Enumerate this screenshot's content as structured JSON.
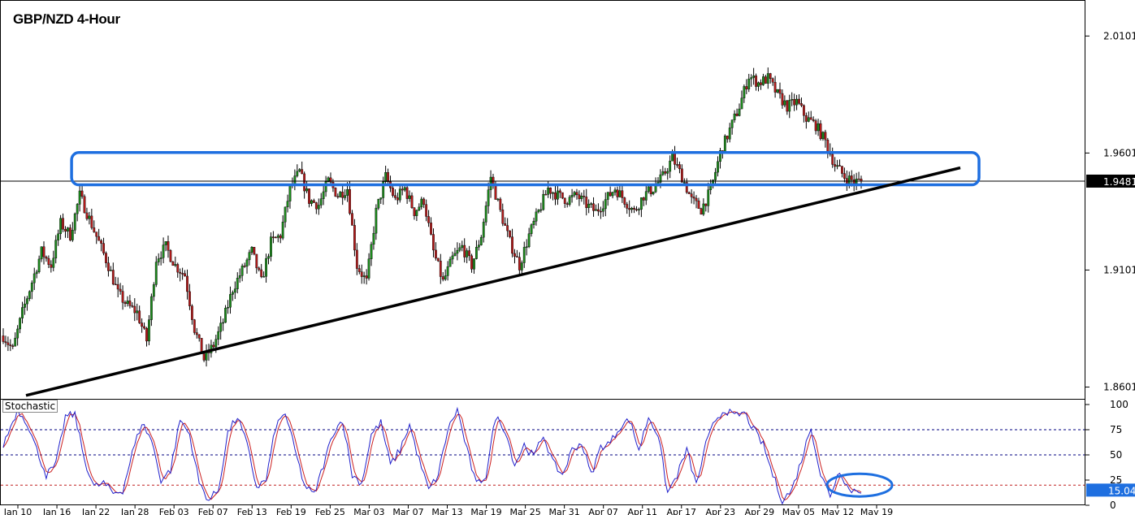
{
  "title": "GBP/NZD 4-Hour",
  "indicator_label": "Stochastic",
  "colors": {
    "bull": "#1c8a1c",
    "bear": "#b31b1b",
    "wick": "#000000",
    "annotation": "#1e6fe0",
    "trendline": "#000000",
    "stoch_main": "#2020cc",
    "stoch_signal": "#cc2020",
    "level_line": "#000080",
    "level_line_red": "#c02020",
    "price_box": "#000000",
    "stoch_box": "#1e6fe0"
  },
  "chart_data": [
    {
      "type": "candlestick",
      "title": "GBP/NZD 4-Hour",
      "y_ticks": [
        "2.0101",
        "1.9601",
        "1.9101",
        "1.8601"
      ],
      "ylim": [
        1.8561,
        2.0241
      ],
      "x_ticks": [
        "Jan 10",
        "Jan 16",
        "Jan 22",
        "Jan 28",
        "Feb 03",
        "Feb 07",
        "Feb 13",
        "Feb 19",
        "Feb 25",
        "Mar 03",
        "Mar 07",
        "Mar 13",
        "Mar 19",
        "Mar 25",
        "Mar 31",
        "Apr 07",
        "Apr 11",
        "Apr 17",
        "Apr 23",
        "Apr 29",
        "May 05",
        "May 12",
        "May 19"
      ],
      "current_price": "1.9481",
      "approx_close_path": [
        [
          0,
          1.882
        ],
        [
          4,
          1.876
        ],
        [
          8,
          1.892
        ],
        [
          12,
          1.905
        ],
        [
          16,
          1.918
        ],
        [
          20,
          1.912
        ],
        [
          24,
          1.93
        ],
        [
          28,
          1.925
        ],
        [
          32,
          1.942
        ],
        [
          36,
          1.932
        ],
        [
          40,
          1.922
        ],
        [
          44,
          1.912
        ],
        [
          48,
          1.9
        ],
        [
          52,
          1.895
        ],
        [
          56,
          1.892
        ],
        [
          60,
          1.88
        ],
        [
          64,
          1.915
        ],
        [
          68,
          1.92
        ],
        [
          72,
          1.912
        ],
        [
          76,
          1.908
        ],
        [
          80,
          1.885
        ],
        [
          84,
          1.872
        ],
        [
          88,
          1.878
        ],
        [
          92,
          1.888
        ],
        [
          96,
          1.902
        ],
        [
          100,
          1.91
        ],
        [
          104,
          1.918
        ],
        [
          108,
          1.905
        ],
        [
          112,
          1.922
        ],
        [
          116,
          1.925
        ],
        [
          120,
          1.945
        ],
        [
          124,
          1.952
        ],
        [
          128,
          1.94
        ],
        [
          132,
          1.938
        ],
        [
          136,
          1.948
        ],
        [
          140,
          1.942
        ],
        [
          144,
          1.945
        ],
        [
          148,
          1.912
        ],
        [
          152,
          1.905
        ],
        [
          156,
          1.935
        ],
        [
          160,
          1.95
        ],
        [
          164,
          1.94
        ],
        [
          168,
          1.945
        ],
        [
          172,
          1.935
        ],
        [
          176,
          1.94
        ],
        [
          180,
          1.918
        ],
        [
          184,
          1.905
        ],
        [
          188,
          1.915
        ],
        [
          192,
          1.92
        ],
        [
          196,
          1.912
        ],
        [
          200,
          1.925
        ],
        [
          204,
          1.95
        ],
        [
          208,
          1.935
        ],
        [
          212,
          1.922
        ],
        [
          216,
          1.912
        ],
        [
          220,
          1.925
        ],
        [
          224,
          1.935
        ],
        [
          228,
          1.945
        ],
        [
          232,
          1.942
        ],
        [
          236,
          1.94
        ],
        [
          240,
          1.942
        ],
        [
          244,
          1.938
        ],
        [
          248,
          1.935
        ],
        [
          252,
          1.94
        ],
        [
          256,
          1.945
        ],
        [
          260,
          1.94
        ],
        [
          264,
          1.935
        ],
        [
          268,
          1.942
        ],
        [
          272,
          1.945
        ],
        [
          276,
          1.95
        ],
        [
          280,
          1.958
        ],
        [
          284,
          1.95
        ],
        [
          288,
          1.94
        ],
        [
          292,
          1.936
        ],
        [
          296,
          1.944
        ],
        [
          300,
          1.96
        ],
        [
          304,
          1.97
        ],
        [
          308,
          1.98
        ],
        [
          312,
          1.993
        ],
        [
          316,
          1.99
        ],
        [
          320,
          1.992
        ],
        [
          324,
          1.985
        ],
        [
          328,
          1.98
        ],
        [
          332,
          1.982
        ],
        [
          336,
          1.975
        ],
        [
          340,
          1.972
        ],
        [
          344,
          1.965
        ],
        [
          348,
          1.955
        ],
        [
          352,
          1.95
        ],
        [
          356,
          1.948
        ]
      ],
      "annotations": [
        {
          "kind": "rounded-rectangle",
          "from_date": "Jan 22",
          "to_date": "May 19",
          "price_low": 1.9465,
          "price_high": 1.9603
        },
        {
          "kind": "trendline",
          "from": [
            "Jan 10",
            1.8565
          ],
          "to": [
            "May 19",
            1.9538
          ]
        }
      ]
    },
    {
      "type": "line",
      "title": "Stochastic",
      "y_ticks": [
        "100",
        "75",
        "50",
        "25",
        "0"
      ],
      "ylim": [
        0,
        100
      ],
      "levels": [
        75,
        50,
        20
      ],
      "current_value": "15.04",
      "approx_k_path": [
        [
          0,
          60
        ],
        [
          6,
          95
        ],
        [
          10,
          82
        ],
        [
          14,
          55
        ],
        [
          18,
          30
        ],
        [
          22,
          40
        ],
        [
          26,
          88
        ],
        [
          30,
          90
        ],
        [
          34,
          45
        ],
        [
          38,
          18
        ],
        [
          42,
          22
        ],
        [
          46,
          12
        ],
        [
          50,
          15
        ],
        [
          54,
          52
        ],
        [
          58,
          82
        ],
        [
          62,
          65
        ],
        [
          66,
          25
        ],
        [
          70,
          35
        ],
        [
          74,
          85
        ],
        [
          78,
          70
        ],
        [
          82,
          22
        ],
        [
          86,
          5
        ],
        [
          90,
          15
        ],
        [
          94,
          72
        ],
        [
          98,
          88
        ],
        [
          102,
          60
        ],
        [
          106,
          18
        ],
        [
          110,
          25
        ],
        [
          114,
          78
        ],
        [
          118,
          92
        ],
        [
          122,
          55
        ],
        [
          126,
          20
        ],
        [
          130,
          10
        ],
        [
          134,
          40
        ],
        [
          138,
          72
        ],
        [
          142,
          85
        ],
        [
          146,
          30
        ],
        [
          150,
          22
        ],
        [
          154,
          70
        ],
        [
          158,
          82
        ],
        [
          162,
          40
        ],
        [
          166,
          55
        ],
        [
          170,
          80
        ],
        [
          174,
          45
        ],
        [
          178,
          15
        ],
        [
          182,
          30
        ],
        [
          186,
          75
        ],
        [
          190,
          95
        ],
        [
          194,
          55
        ],
        [
          198,
          20
        ],
        [
          202,
          30
        ],
        [
          206,
          88
        ],
        [
          210,
          75
        ],
        [
          214,
          40
        ],
        [
          218,
          60
        ],
        [
          222,
          48
        ],
        [
          226,
          70
        ],
        [
          230,
          42
        ],
        [
          234,
          30
        ],
        [
          238,
          55
        ],
        [
          242,
          62
        ],
        [
          246,
          30
        ],
        [
          250,
          58
        ],
        [
          254,
          62
        ],
        [
          258,
          78
        ],
        [
          262,
          85
        ],
        [
          266,
          55
        ],
        [
          270,
          88
        ],
        [
          274,
          70
        ],
        [
          278,
          12
        ],
        [
          282,
          30
        ],
        [
          286,
          55
        ],
        [
          290,
          20
        ],
        [
          294,
          60
        ],
        [
          298,
          85
        ],
        [
          302,
          95
        ],
        [
          306,
          88
        ],
        [
          310,
          92
        ],
        [
          314,
          75
        ],
        [
          318,
          60
        ],
        [
          322,
          30
        ],
        [
          326,
          5
        ],
        [
          330,
          15
        ],
        [
          334,
          45
        ],
        [
          338,
          78
        ],
        [
          342,
          30
        ],
        [
          346,
          10
        ],
        [
          350,
          35
        ],
        [
          354,
          15
        ],
        [
          358,
          15
        ]
      ],
      "annotations": [
        {
          "kind": "ellipse",
          "from_date": "May 12",
          "to_date": "May 19",
          "value_low": 5,
          "value_high": 35
        }
      ]
    }
  ]
}
